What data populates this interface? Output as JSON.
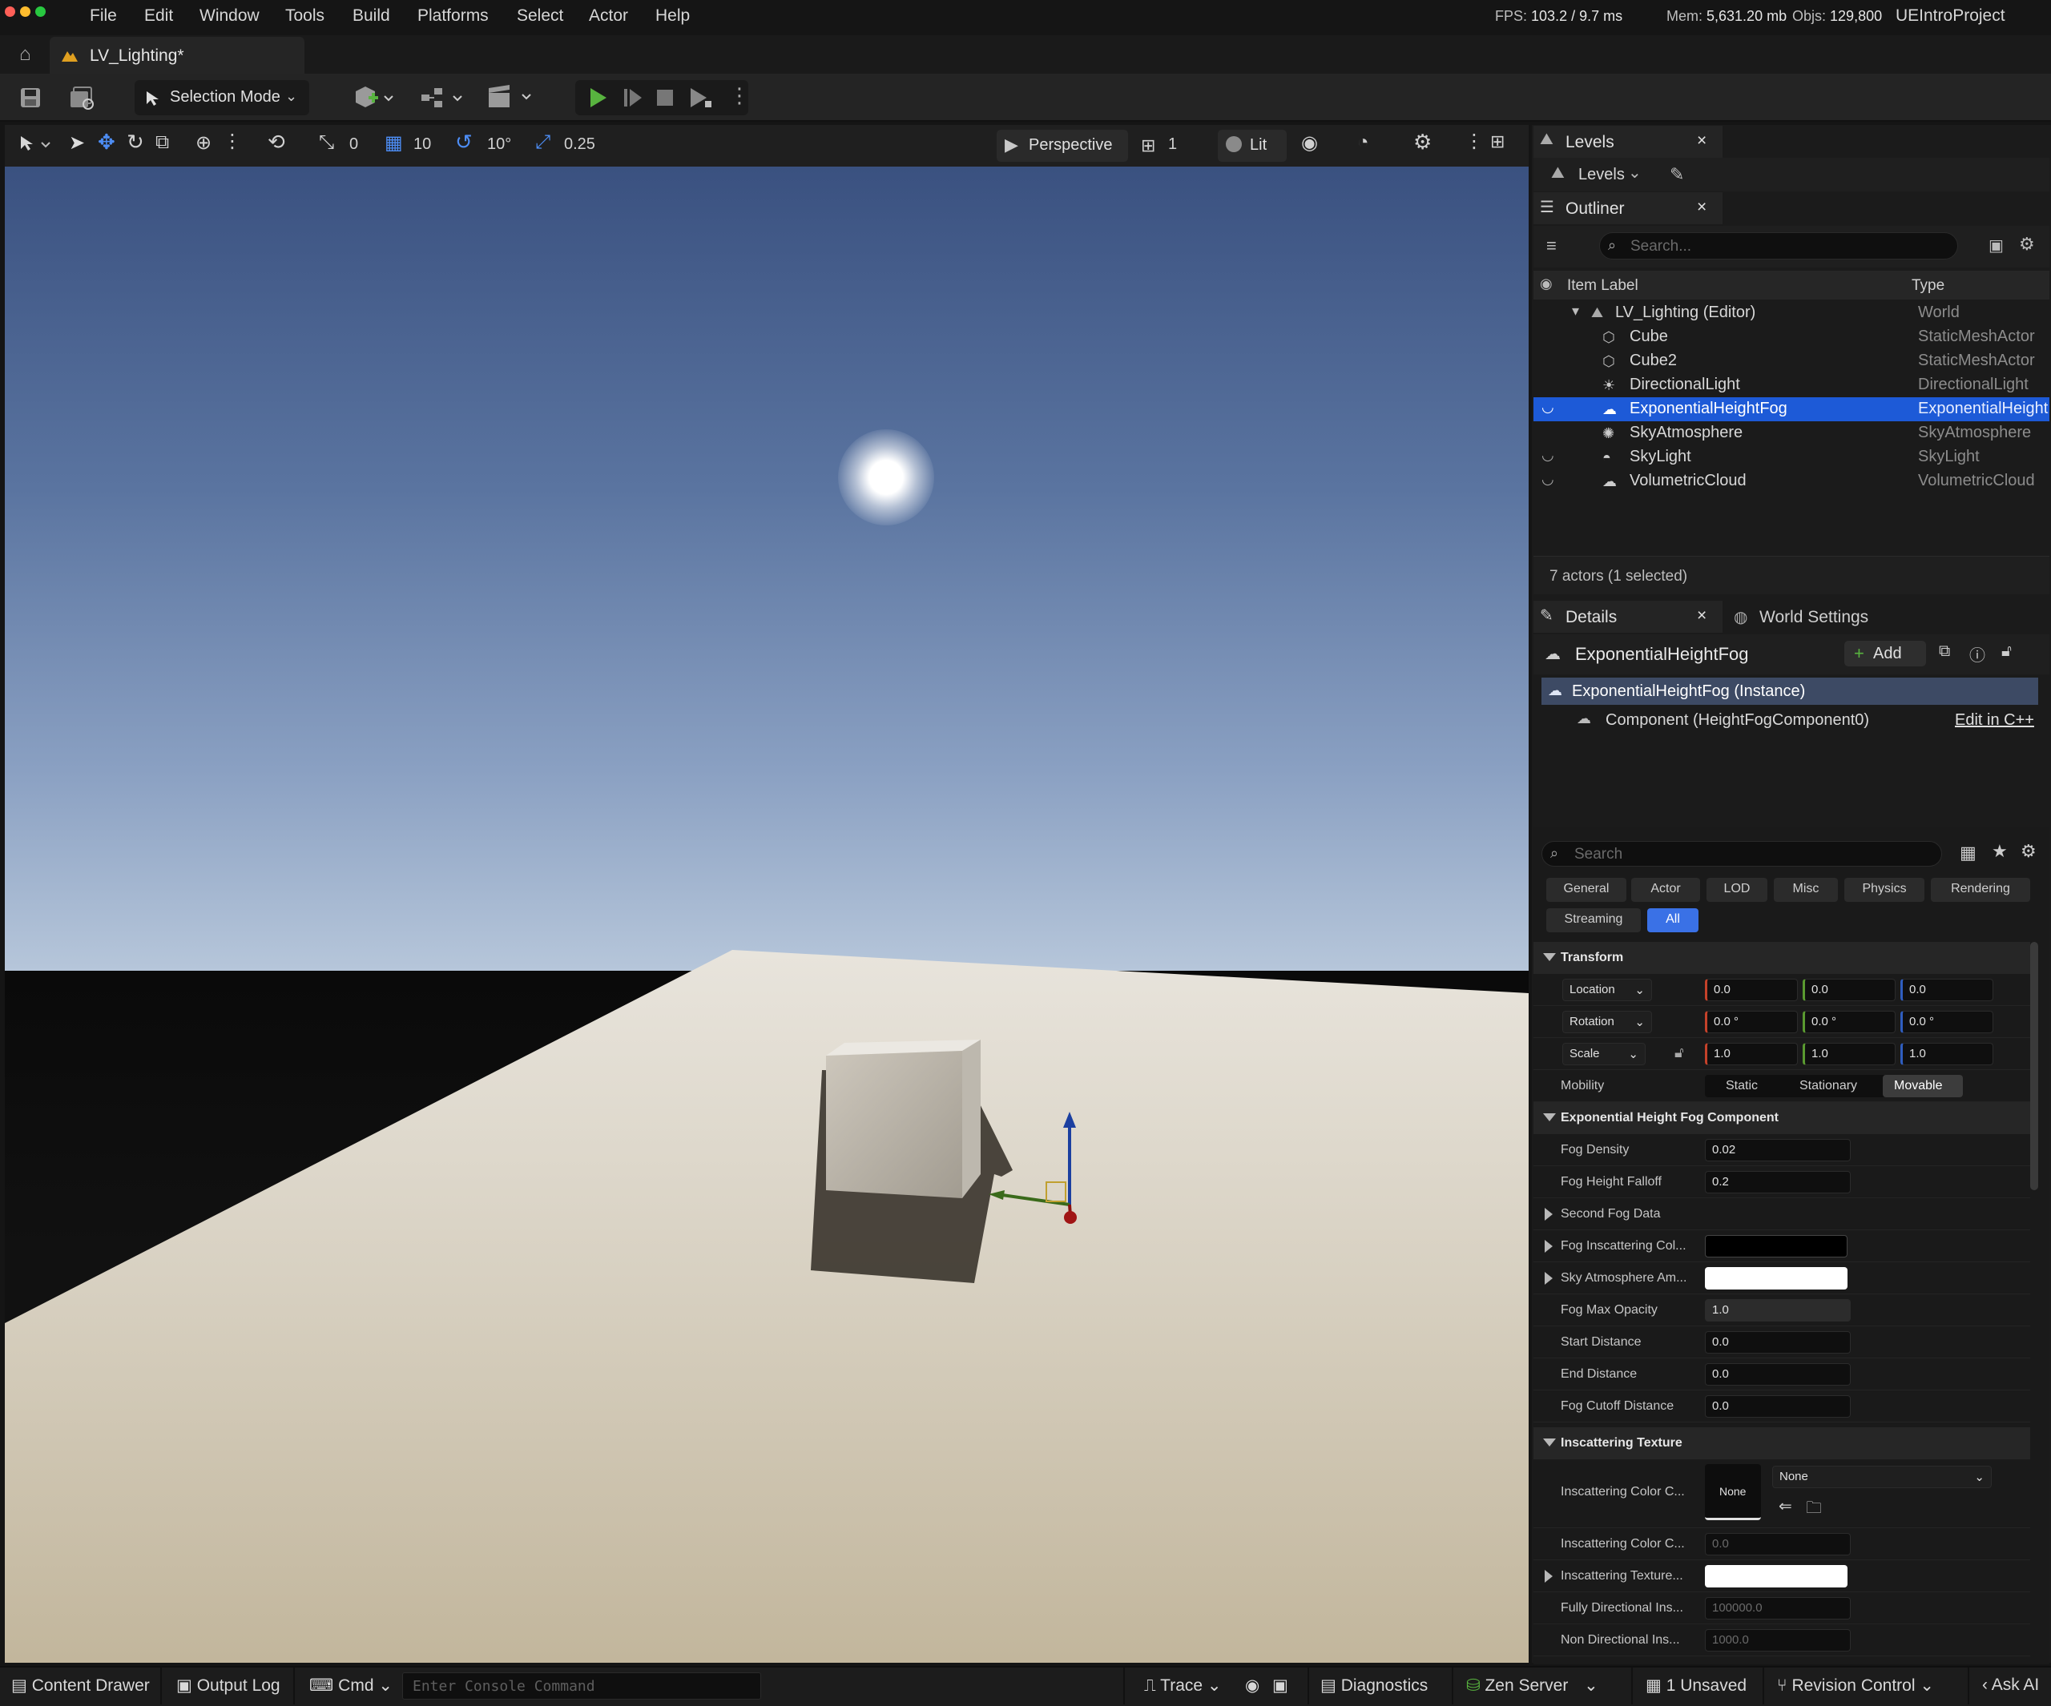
{
  "app": {
    "project": "UEIntroProject",
    "document_tab": "LV_Lighting*"
  },
  "menu": [
    "File",
    "Edit",
    "Window",
    "Tools",
    "Build",
    "Platforms",
    "Select",
    "Actor",
    "Help"
  ],
  "stats": {
    "fps_label": "FPS:",
    "fps": "103.2",
    "frame_ms": "/ 9.7 ms",
    "mem_label": "Mem:",
    "mem": "5,631.20 mb",
    "objs_label": "Objs:",
    "objs": "129,800"
  },
  "toolbar": {
    "selection_mode": "Selection Mode"
  },
  "viewport_toolbar": {
    "rot_snap_val": "0",
    "grid_snap": "10",
    "angle_snap": "10°",
    "scale_snap": "0.25",
    "view_mode": "Perspective",
    "cam_speed": "1",
    "lighting": "Lit"
  },
  "levels_panel": {
    "tab": "Levels",
    "dropdown": "Levels"
  },
  "outliner": {
    "tab": "Outliner",
    "search_placeholder": "Search...",
    "col_label": "Item Label",
    "col_type": "Type",
    "root": {
      "label": "LV_Lighting (Editor)",
      "type": "World"
    },
    "items": [
      {
        "label": "Cube",
        "type": "StaticMeshActor",
        "icon": "cube-icon"
      },
      {
        "label": "Cube2",
        "type": "StaticMeshActor",
        "icon": "cube-icon"
      },
      {
        "label": "DirectionalLight",
        "type": "DirectionalLight",
        "icon": "sun-icon"
      },
      {
        "label": "ExponentialHeightFog",
        "type": "ExponentialHeight",
        "icon": "fog-icon"
      },
      {
        "label": "SkyAtmosphere",
        "type": "SkyAtmosphere",
        "icon": "atmosphere-icon"
      },
      {
        "label": "SkyLight",
        "type": "SkyLight",
        "icon": "skylight-icon"
      },
      {
        "label": "VolumetricCloud",
        "type": "VolumetricCloud",
        "icon": "cloud-icon"
      }
    ],
    "footer": "7 actors (1 selected)"
  },
  "details": {
    "tab": "Details",
    "world_settings_tab": "World Settings",
    "actor_name": "ExponentialHeightFog",
    "add_label": "Add",
    "instance_label": "ExponentialHeightFog (Instance)",
    "component_label": "Component (HeightFogComponent0)",
    "edit_cpp": "Edit in C++",
    "search_placeholder": "Search",
    "categories": [
      "General",
      "Actor",
      "LOD",
      "Misc",
      "Physics",
      "Rendering",
      "Streaming",
      "All"
    ],
    "transform": {
      "title": "Transform",
      "location_label": "Location",
      "location": [
        "0.0",
        "0.0",
        "0.0"
      ],
      "rotation_label": "Rotation",
      "rotation": [
        "0.0 °",
        "0.0 °",
        "0.0 °"
      ],
      "scale_label": "Scale",
      "scale": [
        "1.0",
        "1.0",
        "1.0"
      ],
      "mobility_label": "Mobility",
      "mobility_options": [
        "Static",
        "Stationary",
        "Movable"
      ]
    },
    "fog": {
      "title": "Exponential Height Fog Component",
      "fog_density_label": "Fog Density",
      "fog_density": "0.02",
      "fog_height_falloff_label": "Fog Height Falloff",
      "fog_height_falloff": "0.2",
      "second_fog_label": "Second Fog Data",
      "inscattering_col_label": "Fog Inscattering Col...",
      "sky_atmo_label": "Sky Atmosphere Am...",
      "max_opacity_label": "Fog Max Opacity",
      "max_opacity": "1.0",
      "start_distance_label": "Start Distance",
      "start_distance": "0.0",
      "end_distance_label": "End Distance",
      "end_distance": "0.0",
      "cutoff_label": "Fog Cutoff Distance",
      "cutoff": "0.0"
    },
    "inscattering": {
      "title": "Inscattering Texture",
      "cubemap_label": "Inscattering Color C...",
      "cubemap_thumb": "None",
      "cubemap_value": "None",
      "color_c_label": "Inscattering Color C...",
      "color_c": "0.0",
      "texture_tint_label": "Inscattering Texture...",
      "fully_dir_label": "Fully Directional Ins...",
      "fully_dir": "100000.0",
      "non_dir_label": "Non Directional Ins...",
      "non_dir": "1000.0"
    }
  },
  "statusbar": {
    "content_drawer": "Content Drawer",
    "output_log": "Output Log",
    "cmd": "Cmd",
    "console_placeholder": "Enter Console Command",
    "trace": "Trace",
    "diagnostics": "Diagnostics",
    "zen_server": "Zen Server",
    "unsaved": "1 Unsaved",
    "revision_control": "Revision Control",
    "ask_ai": "Ask AI"
  },
  "colors": {
    "accent": "#1d5ad7",
    "play_green": "#58b33f",
    "fog_inscattering": "#000000",
    "sky_atmo": "#ffffff",
    "texture_tint": "#ffffff"
  }
}
